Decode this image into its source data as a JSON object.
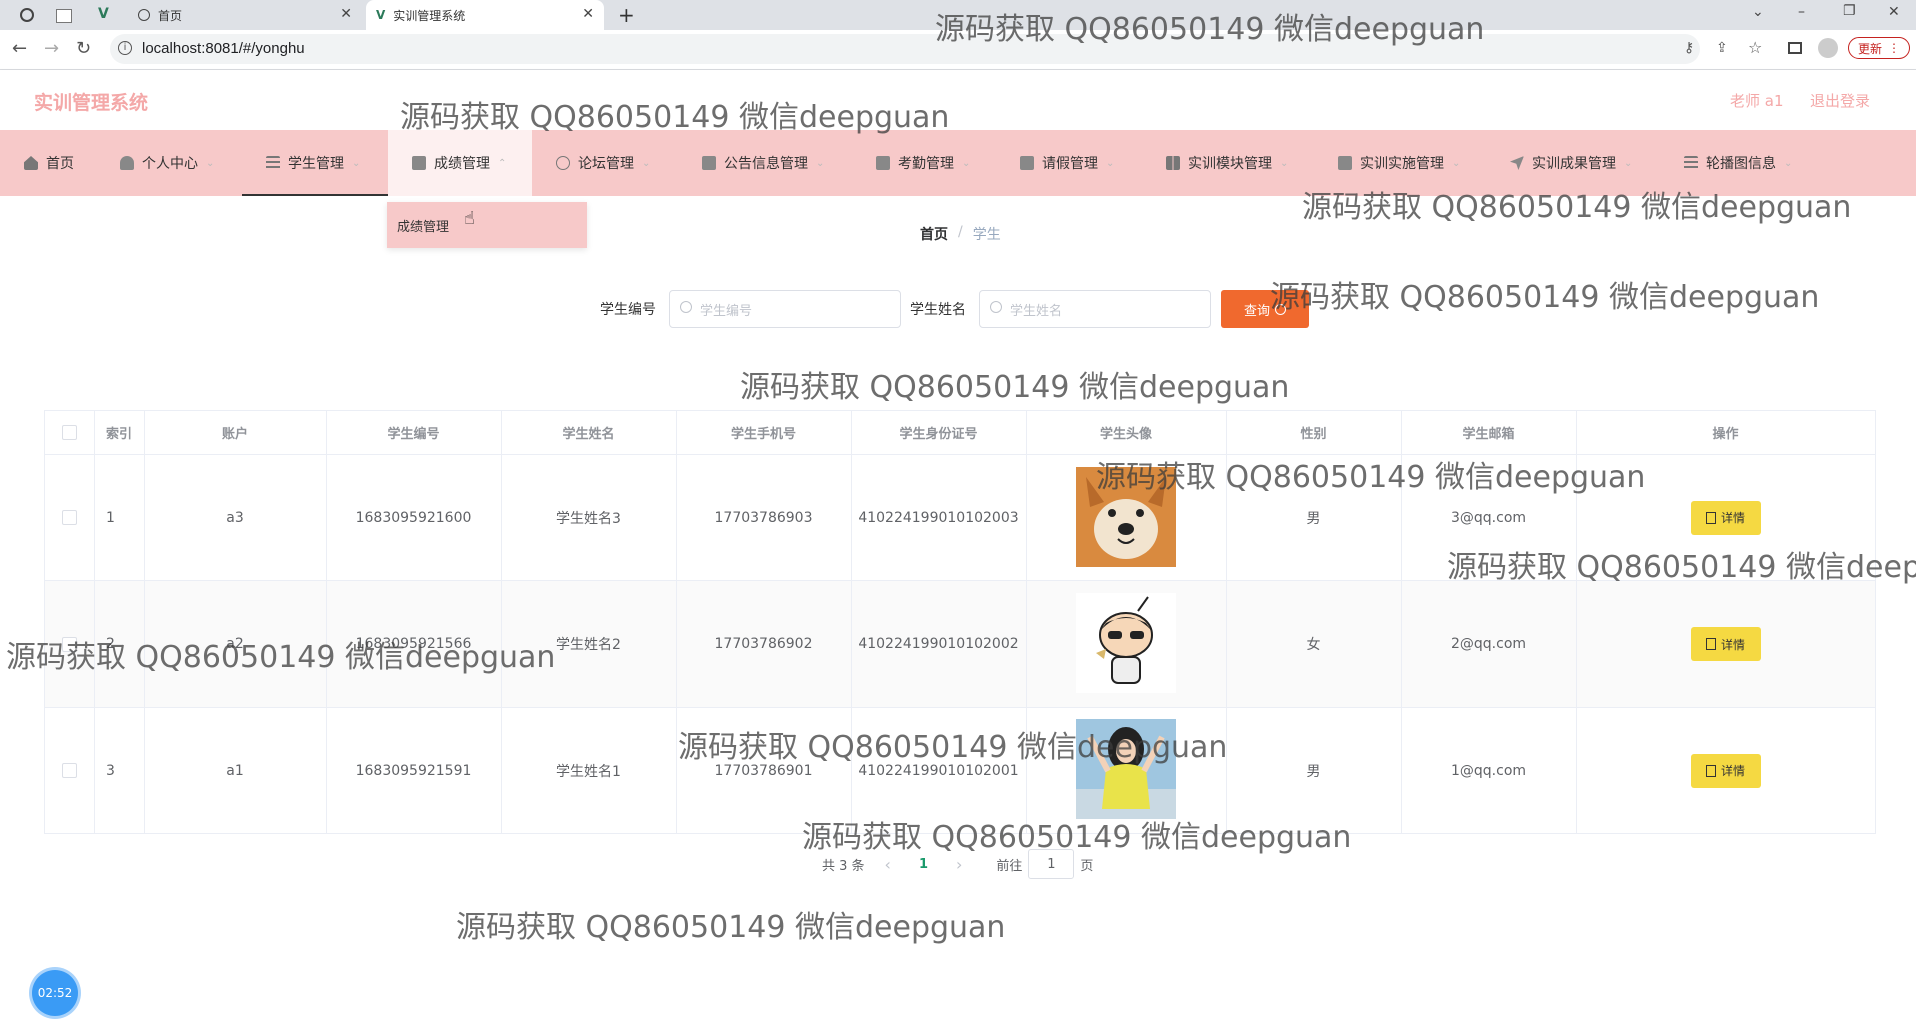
{
  "browser": {
    "tabs": [
      {
        "label": "首页"
      },
      {
        "label": "实训管理系统"
      }
    ],
    "new_tab": "+",
    "url": "localhost:8081/#/yonghu",
    "update_label": "更新"
  },
  "app": {
    "title": "实训管理系统",
    "user_label": "老师 a1",
    "logout_label": "退出登录",
    "accent": "#f7c9c9",
    "title_color": "#f4a8a8"
  },
  "menu": {
    "items": [
      {
        "label": "首页",
        "icon": "home-icon"
      },
      {
        "label": "个人中心",
        "icon": "user-icon"
      },
      {
        "label": "学生管理",
        "icon": "list-icon"
      },
      {
        "label": "成绩管理",
        "icon": "book-icon"
      },
      {
        "label": "论坛管理",
        "icon": "compass-icon"
      },
      {
        "label": "公告信息管理",
        "icon": "notice-icon"
      },
      {
        "label": "考勤管理",
        "icon": "check-icon"
      },
      {
        "label": "请假管理",
        "icon": "chart-icon"
      },
      {
        "label": "实训模块管理",
        "icon": "grid-icon"
      },
      {
        "label": "实训实施管理",
        "icon": "briefcase-icon"
      },
      {
        "label": "实训成果管理",
        "icon": "send-icon"
      },
      {
        "label": "轮播图信息",
        "icon": "menu-icon"
      }
    ],
    "dropdown_item": "成绩管理"
  },
  "breadcrumb": {
    "home": "首页",
    "separator": "/",
    "current": "学生"
  },
  "search": {
    "id_label": "学生编号",
    "id_placeholder": "学生编号",
    "name_label": "学生姓名",
    "name_placeholder": "学生姓名",
    "query_button": "查询",
    "query_color": "#f0692e"
  },
  "table": {
    "headers": [
      "索引",
      "账户",
      "学生编号",
      "学生姓名",
      "学生手机号",
      "学生身份证号",
      "学生头像",
      "性别",
      "学生邮箱",
      "操作"
    ],
    "rows": [
      {
        "index": "1",
        "account": "a3",
        "sid": "1683095921600",
        "name": "学生姓名3",
        "phone": "17703786903",
        "idcard": "410224199010102003",
        "avatar": "shiba-dog-avatar",
        "gender": "男",
        "email": "3@qq.com",
        "action": "详情"
      },
      {
        "index": "2",
        "account": "a2",
        "sid": "1683095921566",
        "name": "学生姓名2",
        "phone": "17703786902",
        "idcard": "410224199010102002",
        "avatar": "cartoon-boy-avatar",
        "gender": "女",
        "email": "2@qq.com",
        "action": "详情"
      },
      {
        "index": "3",
        "account": "a1",
        "sid": "1683095921591",
        "name": "学生姓名1",
        "phone": "17703786901",
        "idcard": "410224199010102001",
        "avatar": "girl-photo-avatar",
        "gender": "男",
        "email": "1@qq.com",
        "action": "详情"
      }
    ]
  },
  "pagination": {
    "total": "共 3 条",
    "prev": "‹",
    "page": "1",
    "next": "›",
    "goto": "前往",
    "goto_value": "1",
    "unit": "页"
  },
  "timer": "02:52",
  "watermark": "源码获取 QQ86050149 微信deepguan"
}
